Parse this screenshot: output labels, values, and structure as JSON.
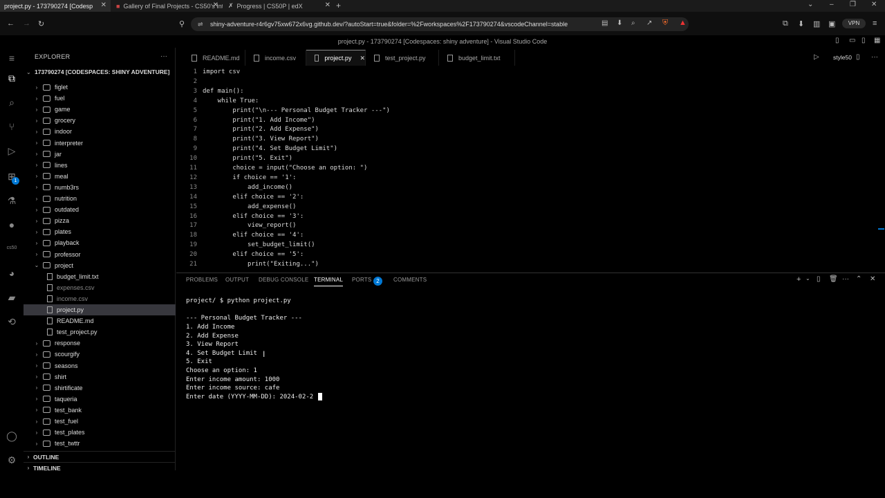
{
  "browser": {
    "tabs": [
      {
        "title": "project.py - 173790274 [Codesp"
      },
      {
        "title": "Gallery of Final Projects - CS50's Intr"
      },
      {
        "title": "Progress | CS50P | edX"
      }
    ],
    "url": "shiny-adventure-r4r6gv75xw672x6vg.github.dev/?autoStart=true&folder=%2Fworkspaces%2F173790274&vscodeChannel=stable",
    "vpn_label": "VPN"
  },
  "window_title": "project.py - 173790274 [Codespaces: shiny adventure] - Visual Studio Code",
  "activity_badge": "1",
  "activity_label_cs50": "cs50",
  "sidebar": {
    "title": "EXPLORER",
    "root": "173790274 [CODESPACES: SHINY ADVENTURE]",
    "items": [
      {
        "label": "figlet",
        "type": "folder"
      },
      {
        "label": "fuel",
        "type": "folder"
      },
      {
        "label": "game",
        "type": "folder"
      },
      {
        "label": "grocery",
        "type": "folder"
      },
      {
        "label": "indoor",
        "type": "folder"
      },
      {
        "label": "interpreter",
        "type": "folder"
      },
      {
        "label": "jar",
        "type": "folder"
      },
      {
        "label": "lines",
        "type": "folder"
      },
      {
        "label": "meal",
        "type": "folder"
      },
      {
        "label": "numb3rs",
        "type": "folder"
      },
      {
        "label": "nutrition",
        "type": "folder"
      },
      {
        "label": "outdated",
        "type": "folder"
      },
      {
        "label": "pizza",
        "type": "folder"
      },
      {
        "label": "plates",
        "type": "folder"
      },
      {
        "label": "playback",
        "type": "folder"
      },
      {
        "label": "professor",
        "type": "folder"
      },
      {
        "label": "project",
        "type": "folder-open"
      },
      {
        "label": "budget_limit.txt",
        "type": "file"
      },
      {
        "label": "expenses.csv",
        "type": "file-dim"
      },
      {
        "label": "income.csv",
        "type": "file-dim"
      },
      {
        "label": "project.py",
        "type": "file-selected"
      },
      {
        "label": "README.md",
        "type": "file"
      },
      {
        "label": "test_project.py",
        "type": "file"
      },
      {
        "label": "response",
        "type": "folder"
      },
      {
        "label": "scourgify",
        "type": "folder"
      },
      {
        "label": "seasons",
        "type": "folder"
      },
      {
        "label": "shirt",
        "type": "folder"
      },
      {
        "label": "shirtificate",
        "type": "folder"
      },
      {
        "label": "taqueria",
        "type": "folder"
      },
      {
        "label": "test_bank",
        "type": "folder"
      },
      {
        "label": "test_fuel",
        "type": "folder"
      },
      {
        "label": "test_plates",
        "type": "folder"
      },
      {
        "label": "test_twttr",
        "type": "folder"
      }
    ],
    "outline": "OUTLINE",
    "timeline": "TIMELINE"
  },
  "editor": {
    "tabs": [
      "README.md",
      "income.csv",
      "project.py",
      "test_project.py",
      "budget_limit.txt"
    ],
    "active_tab": "project.py",
    "style_label": "style50",
    "lines": [
      "import csv",
      "",
      "def main():",
      "    while True:",
      "        print(\"\\n--- Personal Budget Tracker ---\")",
      "        print(\"1. Add Income\")",
      "        print(\"2. Add Expense\")",
      "        print(\"3. View Report\")",
      "        print(\"4. Set Budget Limit\")",
      "        print(\"5. Exit\")",
      "        choice = input(\"Choose an option: \")",
      "        if choice == '1':",
      "            add_income()",
      "        elif choice == '2':",
      "            add_expense()",
      "        elif choice == '3':",
      "            view_report()",
      "        elif choice == '4':",
      "            set_budget_limit()",
      "        elif choice == '5':",
      "            print(\"Exiting...\")"
    ]
  },
  "panel": {
    "tabs": [
      "PROBLEMS",
      "OUTPUT",
      "DEBUG CONSOLE",
      "TERMINAL",
      "PORTS",
      "COMMENTS"
    ],
    "active_tab": "TERMINAL",
    "ports_count": "2",
    "terminal": [
      "project/ $ python project.py",
      "",
      "--- Personal Budget Tracker ---",
      "1. Add Income",
      "2. Add Expense",
      "3. View Report",
      "4. Set Budget Limit",
      "5. Exit",
      "Choose an option: 1",
      "Enter income amount: 1000",
      "Enter income source: cafe",
      "Enter date (YYYY-MM-DD): 2024-02-2"
    ]
  }
}
